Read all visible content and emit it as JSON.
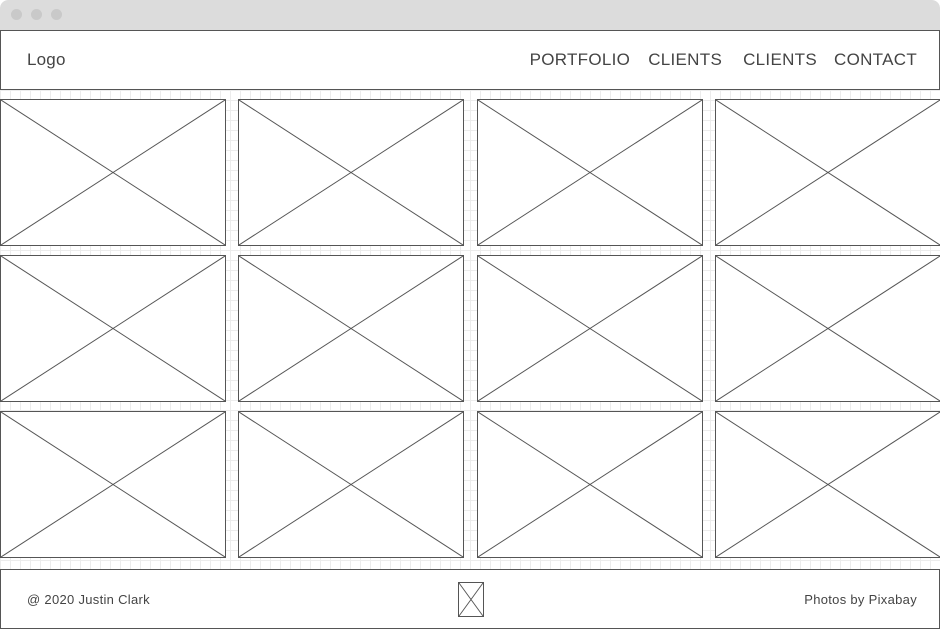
{
  "header": {
    "logo": "Logo",
    "nav": [
      "PORTFOLIO",
      "CLIENTS",
      "CLIENTS",
      "CONTACT"
    ]
  },
  "gallery": {
    "rows": 3,
    "columns": 4,
    "placeholder_icon": "image-placeholder-icon"
  },
  "footer": {
    "copyright": "@ 2020 Justin Clark",
    "credit": "Photos by Pixabay",
    "center_icon": "image-placeholder-icon"
  },
  "colors": {
    "titlebar": "#dcdcdc",
    "window_dot": "#c9c9c9",
    "stroke": "#555555",
    "text": "#444444",
    "grid": "#ececec"
  }
}
